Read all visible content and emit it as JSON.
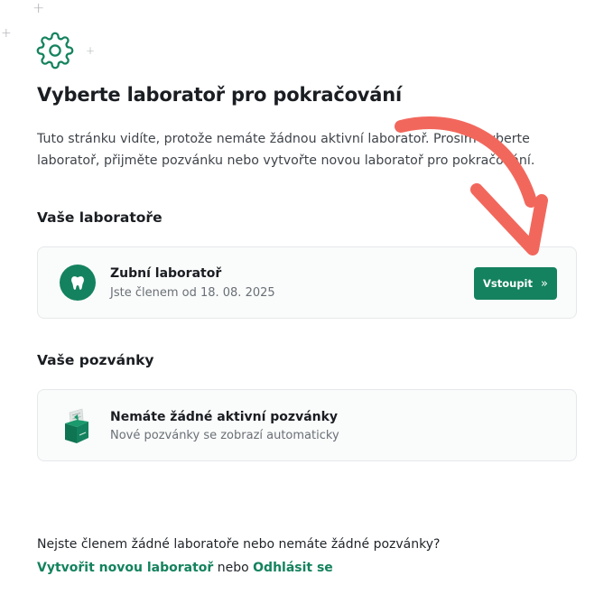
{
  "decor": {
    "plus_glyph": "+"
  },
  "icons": {
    "header": "gear-icon",
    "lab": "tooth-icon",
    "enter_button": "double-chevron-right-icon",
    "invitations_empty": "envelope-illustration-icon",
    "annotation": "curved-arrow-icon"
  },
  "colors": {
    "accent": "#14825e",
    "annotation_arrow": "#f2675c",
    "card_background": "#fafbfb",
    "card_border": "#e6e8eb"
  },
  "page": {
    "title": "Vyberte laboratoř pro pokračování",
    "description": "Tuto stránku vidíte, protože nemáte žádnou aktivní laboratoř. Prosím vyberte laboratoř, přijměte pozvánku nebo vytvořte novou laboratoř pro pokračování."
  },
  "labs": {
    "heading": "Vaše laboratoře",
    "items": [
      {
        "name": "Zubní laboratoř",
        "member_since": "Jste členem od 18. 08. 2025",
        "button_label": "Vstoupit",
        "button_chevron": "»"
      }
    ]
  },
  "invitations": {
    "heading": "Vaše pozvánky",
    "empty_title": "Nemáte žádné aktivní pozvánky",
    "empty_subtitle": "Nové pozvánky se zobrazí automaticky"
  },
  "footer": {
    "question": "Nejste členem žádné laboratoře nebo nemáte žádné pozvánky?",
    "create_link": "Vytvořit novou laboratoř",
    "connector": " nebo ",
    "logout_link": "Odhlásit se"
  }
}
